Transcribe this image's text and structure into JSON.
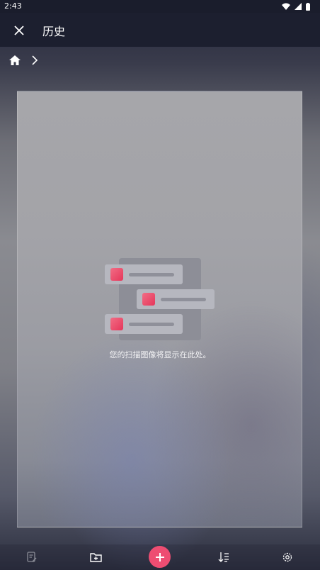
{
  "status": {
    "time": "2:43"
  },
  "appbar": {
    "title": "历史"
  },
  "breadcrumb": {
    "home": "home-icon",
    "separator": "chevron-right-icon"
  },
  "empty_state": {
    "message": "您的扫描图像将显示在此处。"
  },
  "bottom_bar": {
    "items": [
      "edit-document-icon",
      "add-folder-icon",
      "add-scan-button",
      "sort-icon",
      "settings-icon"
    ]
  },
  "colors": {
    "accent": "#ee4d72",
    "appbar": "#1c1f2f"
  }
}
